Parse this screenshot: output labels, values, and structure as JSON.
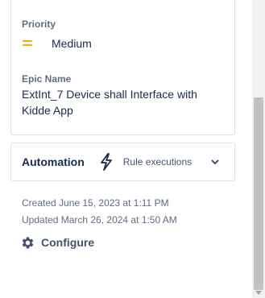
{
  "details": {
    "priority_label": "Priority",
    "priority_value": "Medium",
    "priority_icon": "priority-medium-icon",
    "priority_color": "#ffab00",
    "epic_label": "Epic Name",
    "epic_value": "ExtInt_7 Device shall Interface with Kidde App"
  },
  "automation": {
    "title": "Automation",
    "bolt_icon": "lightning-bolt-icon",
    "rule_executions_label": "Rule executions",
    "chevron_icon": "chevron-down-icon"
  },
  "meta": {
    "created": "Created June 15, 2023 at 1:11 PM",
    "updated": "Updated March 26, 2024 at 1:50 AM"
  },
  "configure": {
    "label": "Configure",
    "icon": "gear-icon"
  }
}
